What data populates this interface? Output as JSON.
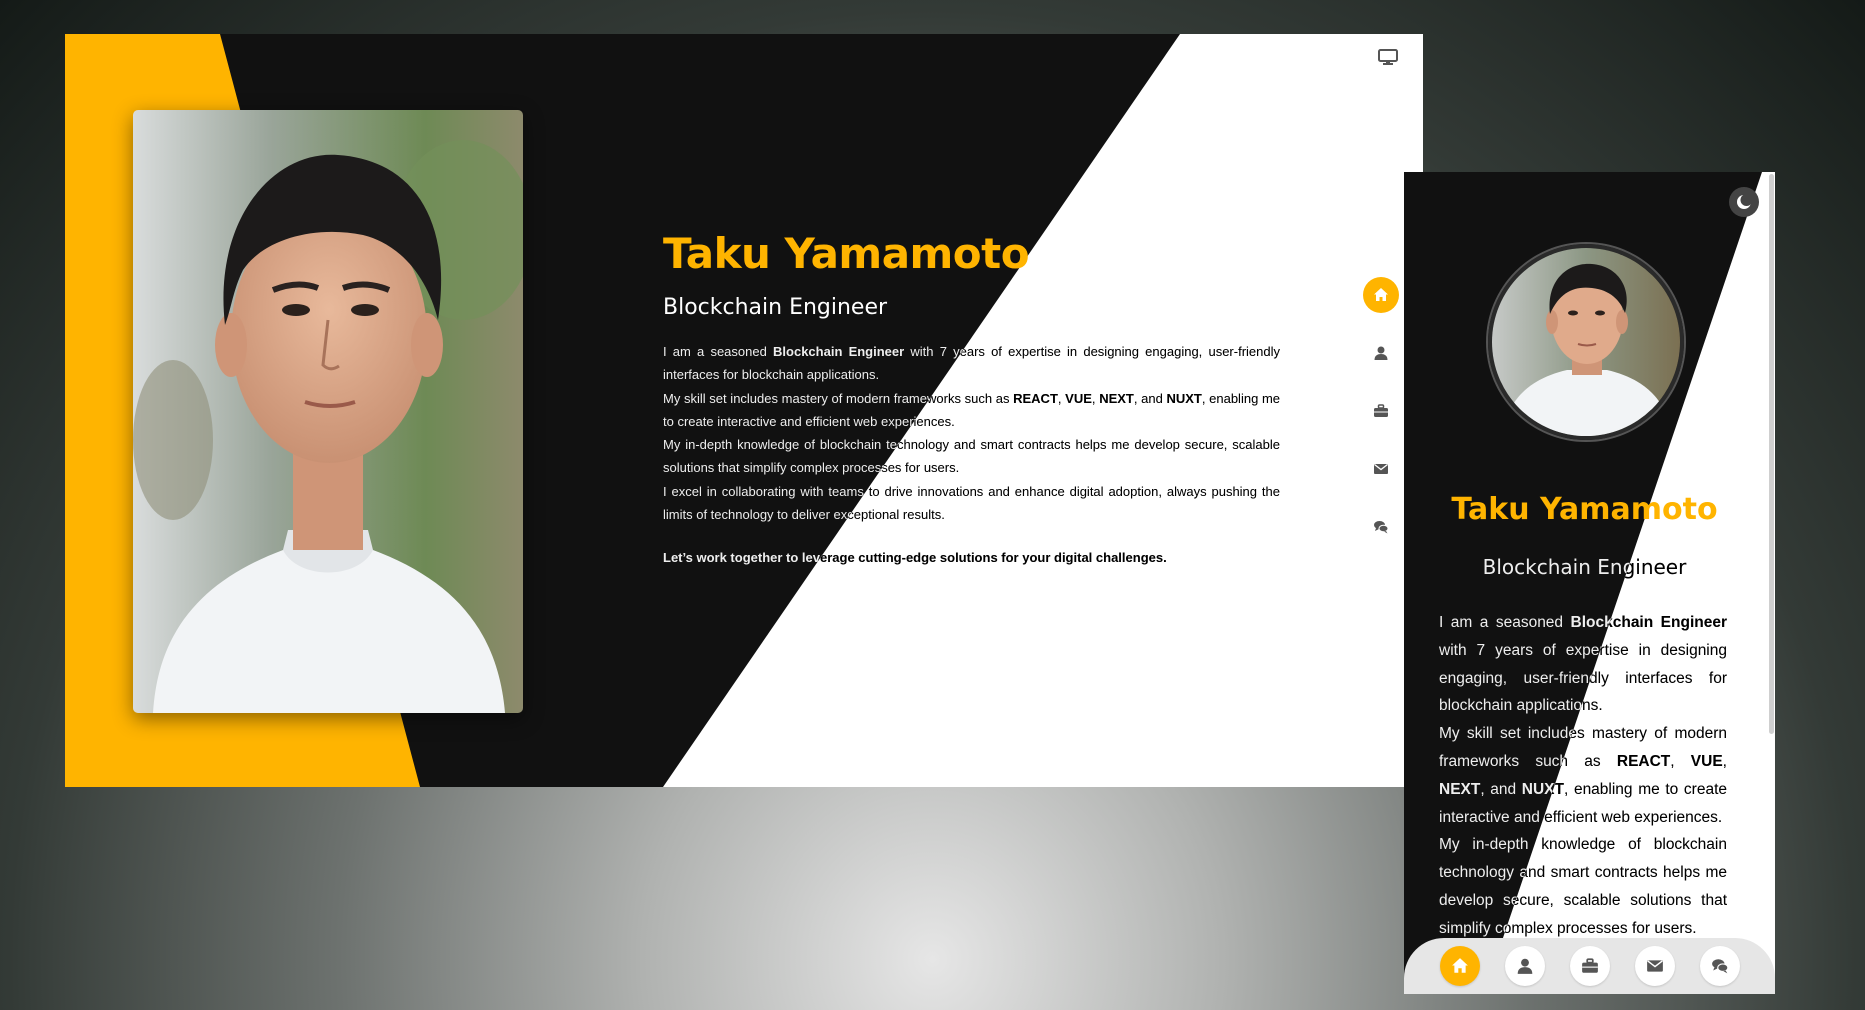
{
  "profile": {
    "name": "Taku Yamamoto",
    "role": "Blockchain Engineer",
    "paragraphs": [
      [
        {
          "t": "I am a seasoned "
        },
        {
          "t": "Blockchain Engineer",
          "b": true
        },
        {
          "t": " with 7 years of expertise in designing engaging, user-friendly interfaces for blockchain applications."
        }
      ],
      [
        {
          "t": "My skill set includes mastery of modern frameworks such as "
        },
        {
          "t": "REACT",
          "b": true
        },
        {
          "t": ", "
        },
        {
          "t": "VUE",
          "b": true
        },
        {
          "t": ", "
        },
        {
          "t": "NEXT",
          "b": true
        },
        {
          "t": ", and "
        },
        {
          "t": "NUXT",
          "b": true
        },
        {
          "t": ", enabling me to create interactive and efficient web experiences."
        }
      ],
      [
        {
          "t": "My in-depth knowledge of blockchain technology and smart contracts helps me develop secure, scalable solutions that simplify complex processes for users."
        }
      ],
      [
        {
          "t": "I excel in collaborating with teams to drive innovations and enhance digital adoption, always pushing the limits of technology to deliver exceptional results."
        }
      ]
    ],
    "cta": "Let’s work together to leverage cutting-edge solutions for your digital challenges."
  },
  "nav": {
    "items": [
      {
        "id": "home",
        "icon": "home-icon",
        "active": true
      },
      {
        "id": "about",
        "icon": "user-icon",
        "active": false
      },
      {
        "id": "portfolio",
        "icon": "briefcase-icon",
        "active": false
      },
      {
        "id": "contact",
        "icon": "envelope-icon",
        "active": false
      },
      {
        "id": "blog",
        "icon": "comments-icon",
        "active": false
      }
    ]
  },
  "theme": {
    "accent": "#ffb400",
    "dark": "#111111",
    "light": "#ffffff",
    "toggle_icon": "theme-toggle-icon",
    "display_icon": "desktop-display-icon"
  }
}
